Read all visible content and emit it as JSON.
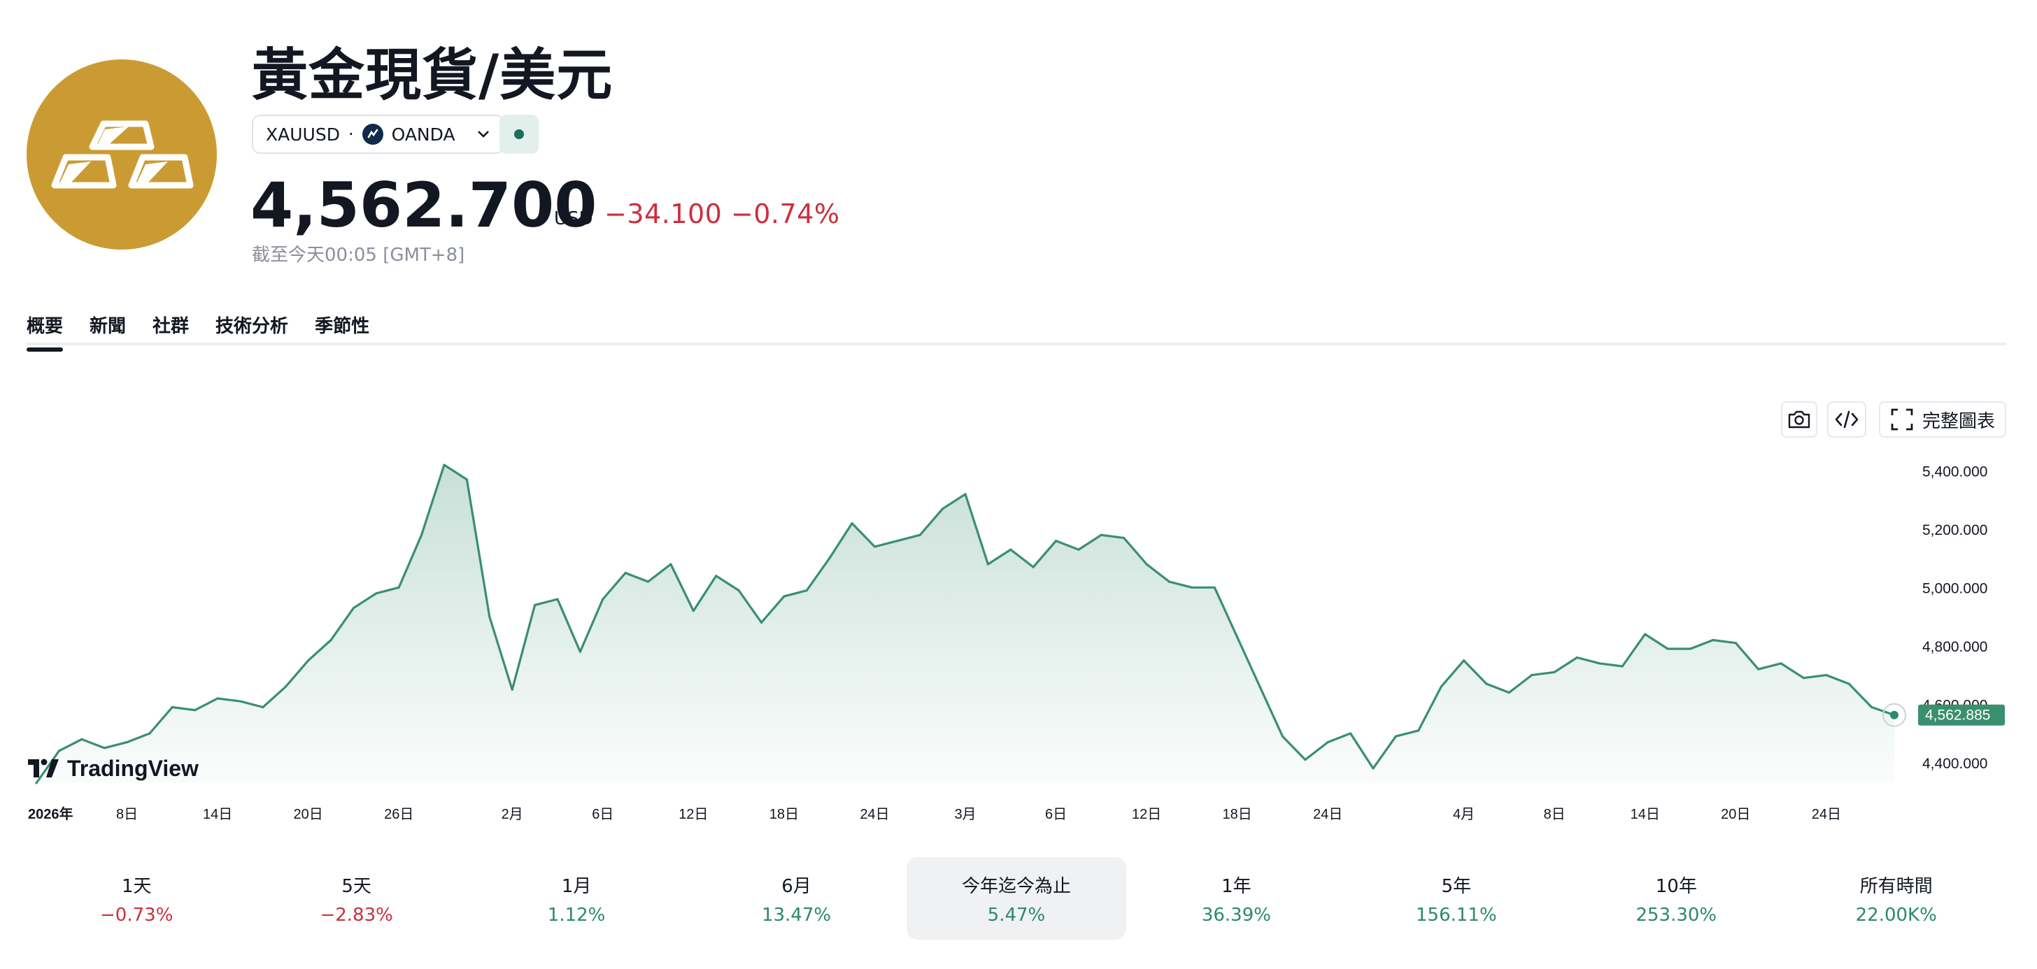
{
  "header": {
    "title": "黃金現貨/美元",
    "symbol": "XAUUSD",
    "separator": "·",
    "exchange": "OANDA",
    "price": "4,562.700",
    "currency": "USD",
    "change": "−34.100",
    "change_pct": "−0.74%",
    "as_of": "截至今天00:05 [GMT+8]"
  },
  "tabs": [
    "概要",
    "新聞",
    "社群",
    "技術分析",
    "季節性"
  ],
  "toolbar": {
    "full_chart_label": "完整圖表"
  },
  "brand": {
    "wordmark": "TradingView"
  },
  "colors": {
    "logo": "#cb9b33",
    "line": "#3a8f6f",
    "negative": "#cc2f3c",
    "positive": "#2a8a6a"
  },
  "chart_data": {
    "type": "area",
    "ylim": [
      4330,
      5480
    ],
    "y_ticks": [
      4400,
      4600,
      4800,
      5000,
      5200,
      5400
    ],
    "y_tick_labels": [
      "4,400.000",
      "4,600.000",
      "4,800.000",
      "5,000.000",
      "5,200.000",
      "5,400.000"
    ],
    "x_tick_labels": [
      "2026年",
      "8日",
      "14日",
      "20日",
      "26日",
      "2月",
      "6日",
      "12日",
      "18日",
      "24日",
      "3月",
      "6日",
      "12日",
      "18日",
      "24日",
      "4月",
      "8日",
      "14日",
      "20日",
      "24日"
    ],
    "x_tick_positions": [
      0,
      4,
      8,
      12,
      16,
      21,
      25,
      29,
      33,
      37,
      41,
      45,
      49,
      53,
      57,
      63,
      67,
      71,
      75,
      79
    ],
    "last_value_label": "4,562.885",
    "values": [
      4330,
      4440,
      4480,
      4450,
      4470,
      4500,
      4590,
      4580,
      4620,
      4610,
      4590,
      4660,
      4750,
      4820,
      4930,
      4980,
      5000,
      5180,
      5420,
      5370,
      4900,
      4650,
      4940,
      4960,
      4780,
      4960,
      5050,
      5020,
      5080,
      4920,
      5040,
      4990,
      4880,
      4970,
      4990,
      5100,
      5220,
      5140,
      5160,
      5180,
      5270,
      5320,
      5080,
      5130,
      5070,
      5160,
      5130,
      5180,
      5170,
      5080,
      5020,
      5000,
      5000,
      4830,
      4660,
      4490,
      4410,
      4470,
      4500,
      4380,
      4490,
      4510,
      4660,
      4750,
      4670,
      4640,
      4700,
      4710,
      4760,
      4740,
      4730,
      4840,
      4790,
      4790,
      4820,
      4810,
      4720,
      4740,
      4690,
      4700,
      4670,
      4590,
      4563
    ]
  },
  "periods": [
    {
      "label": "1天",
      "value": "−0.73%",
      "trend": "neg"
    },
    {
      "label": "5天",
      "value": "−2.83%",
      "trend": "neg"
    },
    {
      "label": "1月",
      "value": "1.12%",
      "trend": "pos"
    },
    {
      "label": "6月",
      "value": "13.47%",
      "trend": "pos"
    },
    {
      "label": "今年迄今為止",
      "value": "5.47%",
      "trend": "pos"
    },
    {
      "label": "1年",
      "value": "36.39%",
      "trend": "pos"
    },
    {
      "label": "5年",
      "value": "156.11%",
      "trend": "pos"
    },
    {
      "label": "10年",
      "value": "253.30%",
      "trend": "pos"
    },
    {
      "label": "所有時間",
      "value": "22.00K%",
      "trend": "pos"
    }
  ]
}
